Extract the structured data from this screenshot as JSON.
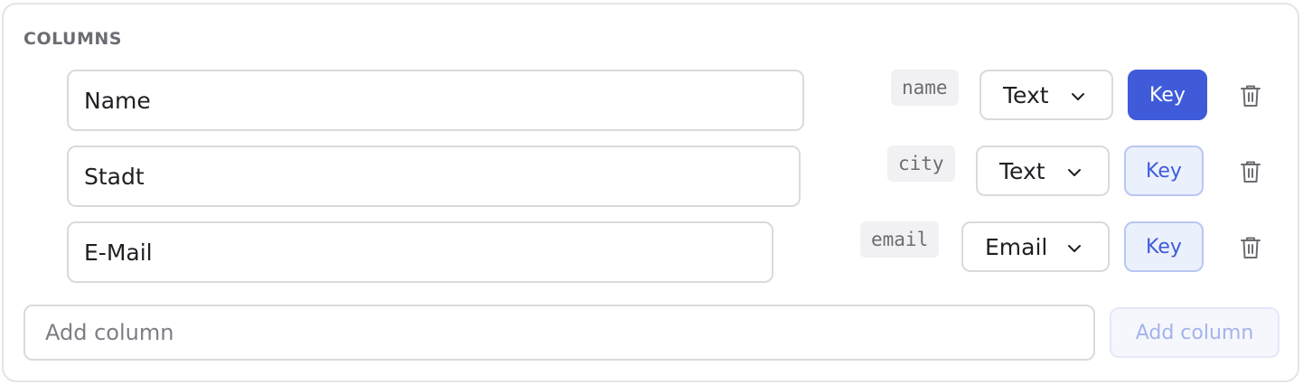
{
  "section": {
    "title": "COLUMNS"
  },
  "columns": [
    {
      "label": "Name",
      "key": "name",
      "type": "Text",
      "key_label": "Key",
      "is_key": true
    },
    {
      "label": "Stadt",
      "key": "city",
      "type": "Text",
      "key_label": "Key",
      "is_key": false
    },
    {
      "label": "E-Mail",
      "key": "email",
      "type": "Email",
      "key_label": "Key",
      "is_key": false
    }
  ],
  "add": {
    "placeholder": "Add column",
    "value": "",
    "button_label": "Add column",
    "button_disabled": true
  },
  "icons": {
    "type_dropdown": "chevron-down-icon",
    "delete": "trash-icon"
  },
  "colors": {
    "accent": "#3f5bd9",
    "accent_soft": "#ebf0fd",
    "border": "#d9dadd",
    "muted_text": "#6b6d73"
  }
}
